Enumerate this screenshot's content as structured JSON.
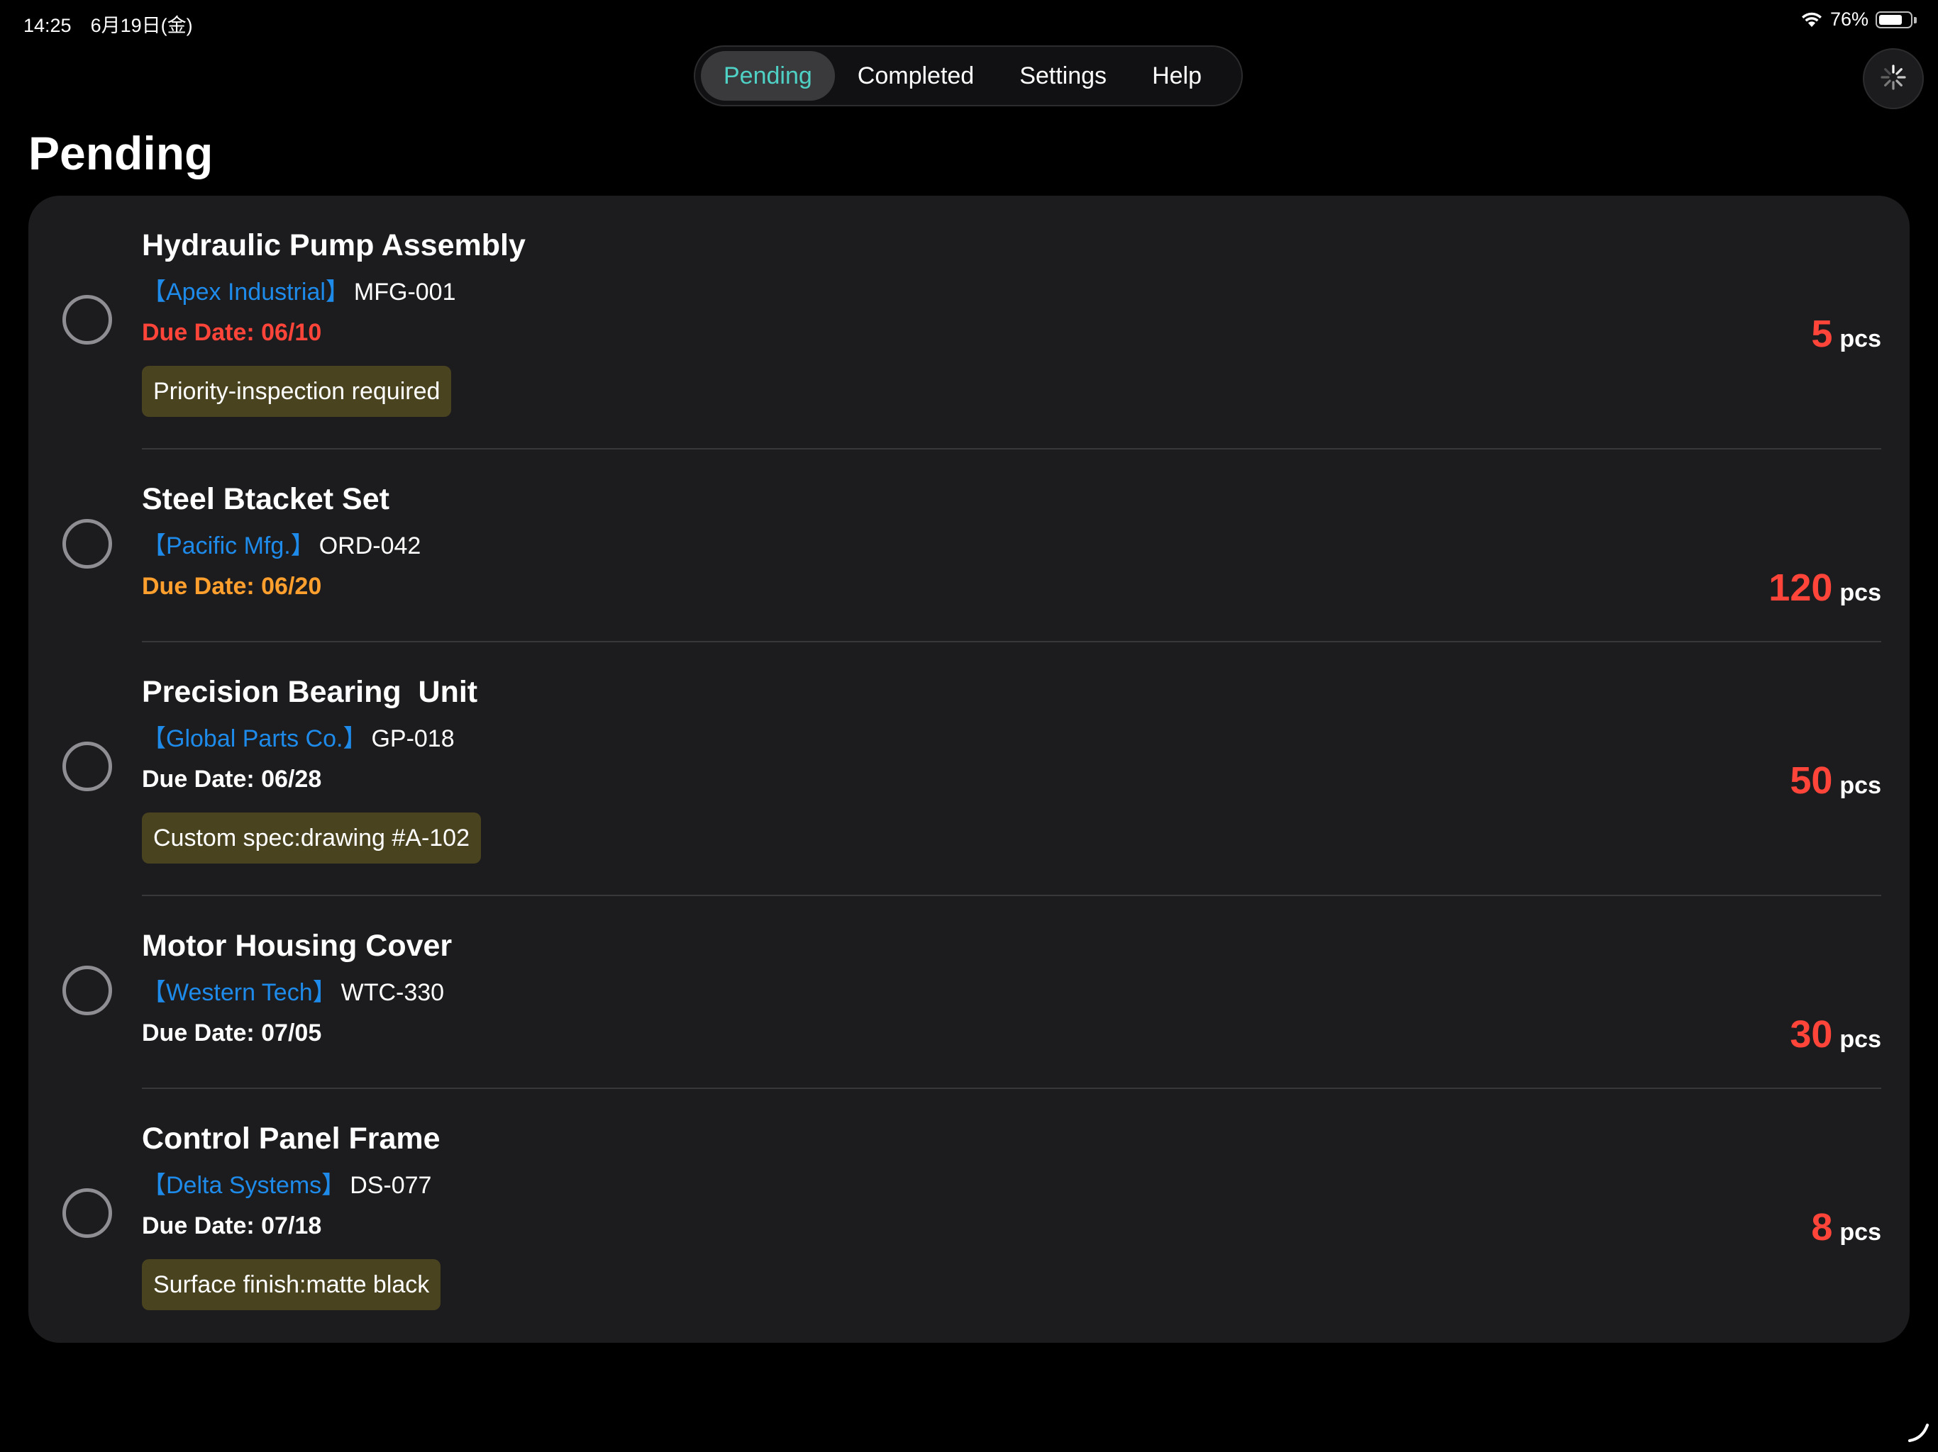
{
  "status_bar": {
    "time": "14:25　6月19日(金)",
    "battery": "76%",
    "battery_level": 0.76
  },
  "tabs": [
    {
      "label": "Pending",
      "active": true
    },
    {
      "label": "Completed",
      "active": false
    },
    {
      "label": "Settings",
      "active": false
    },
    {
      "label": "Help",
      "active": false
    }
  ],
  "page": {
    "title": "Pending"
  },
  "colors": {
    "accent_tab": "#4fd1c5",
    "customer": "#1e8bea",
    "quantity": "#ff453a",
    "due_overdue": "#ff453a",
    "due_soon": "#ff9f2e",
    "due_normal": "#ffffff",
    "tag_background": "#4a4320"
  },
  "items": [
    {
      "title": "Hydraulic Pump Assembly",
      "customer": "【Apex Industrial】",
      "order_no": "MFG-001",
      "due": "Due Date: 06/10",
      "due_status": "overdue",
      "tag": "Priority-inspection required",
      "quantity": "5",
      "unit": "pcs"
    },
    {
      "title": "Steel Btacket Set",
      "customer": "【Pacific Mfg.】",
      "order_no": "ORD-042",
      "due": "Due Date: 06/20",
      "due_status": "soon",
      "tag": "",
      "quantity": "120",
      "unit": "pcs"
    },
    {
      "title": "Precision Bearing  Unit",
      "customer": "【Global Parts Co.】",
      "order_no": "GP-018",
      "due": "Due Date: 06/28",
      "due_status": "normal",
      "tag": "Custom spec:drawing #A-102",
      "quantity": "50",
      "unit": "pcs"
    },
    {
      "title": "Motor Housing Cover",
      "customer": "【Western Tech】",
      "order_no": "WTC-330",
      "due": "Due Date: 07/05",
      "due_status": "normal",
      "tag": "",
      "quantity": "30",
      "unit": "pcs"
    },
    {
      "title": "Control Panel Frame",
      "customer": "【Delta Systems】",
      "order_no": "DS-077",
      "due": "Due Date: 07/18",
      "due_status": "normal",
      "tag": "Surface finish:matte black",
      "quantity": "8",
      "unit": "pcs"
    }
  ]
}
